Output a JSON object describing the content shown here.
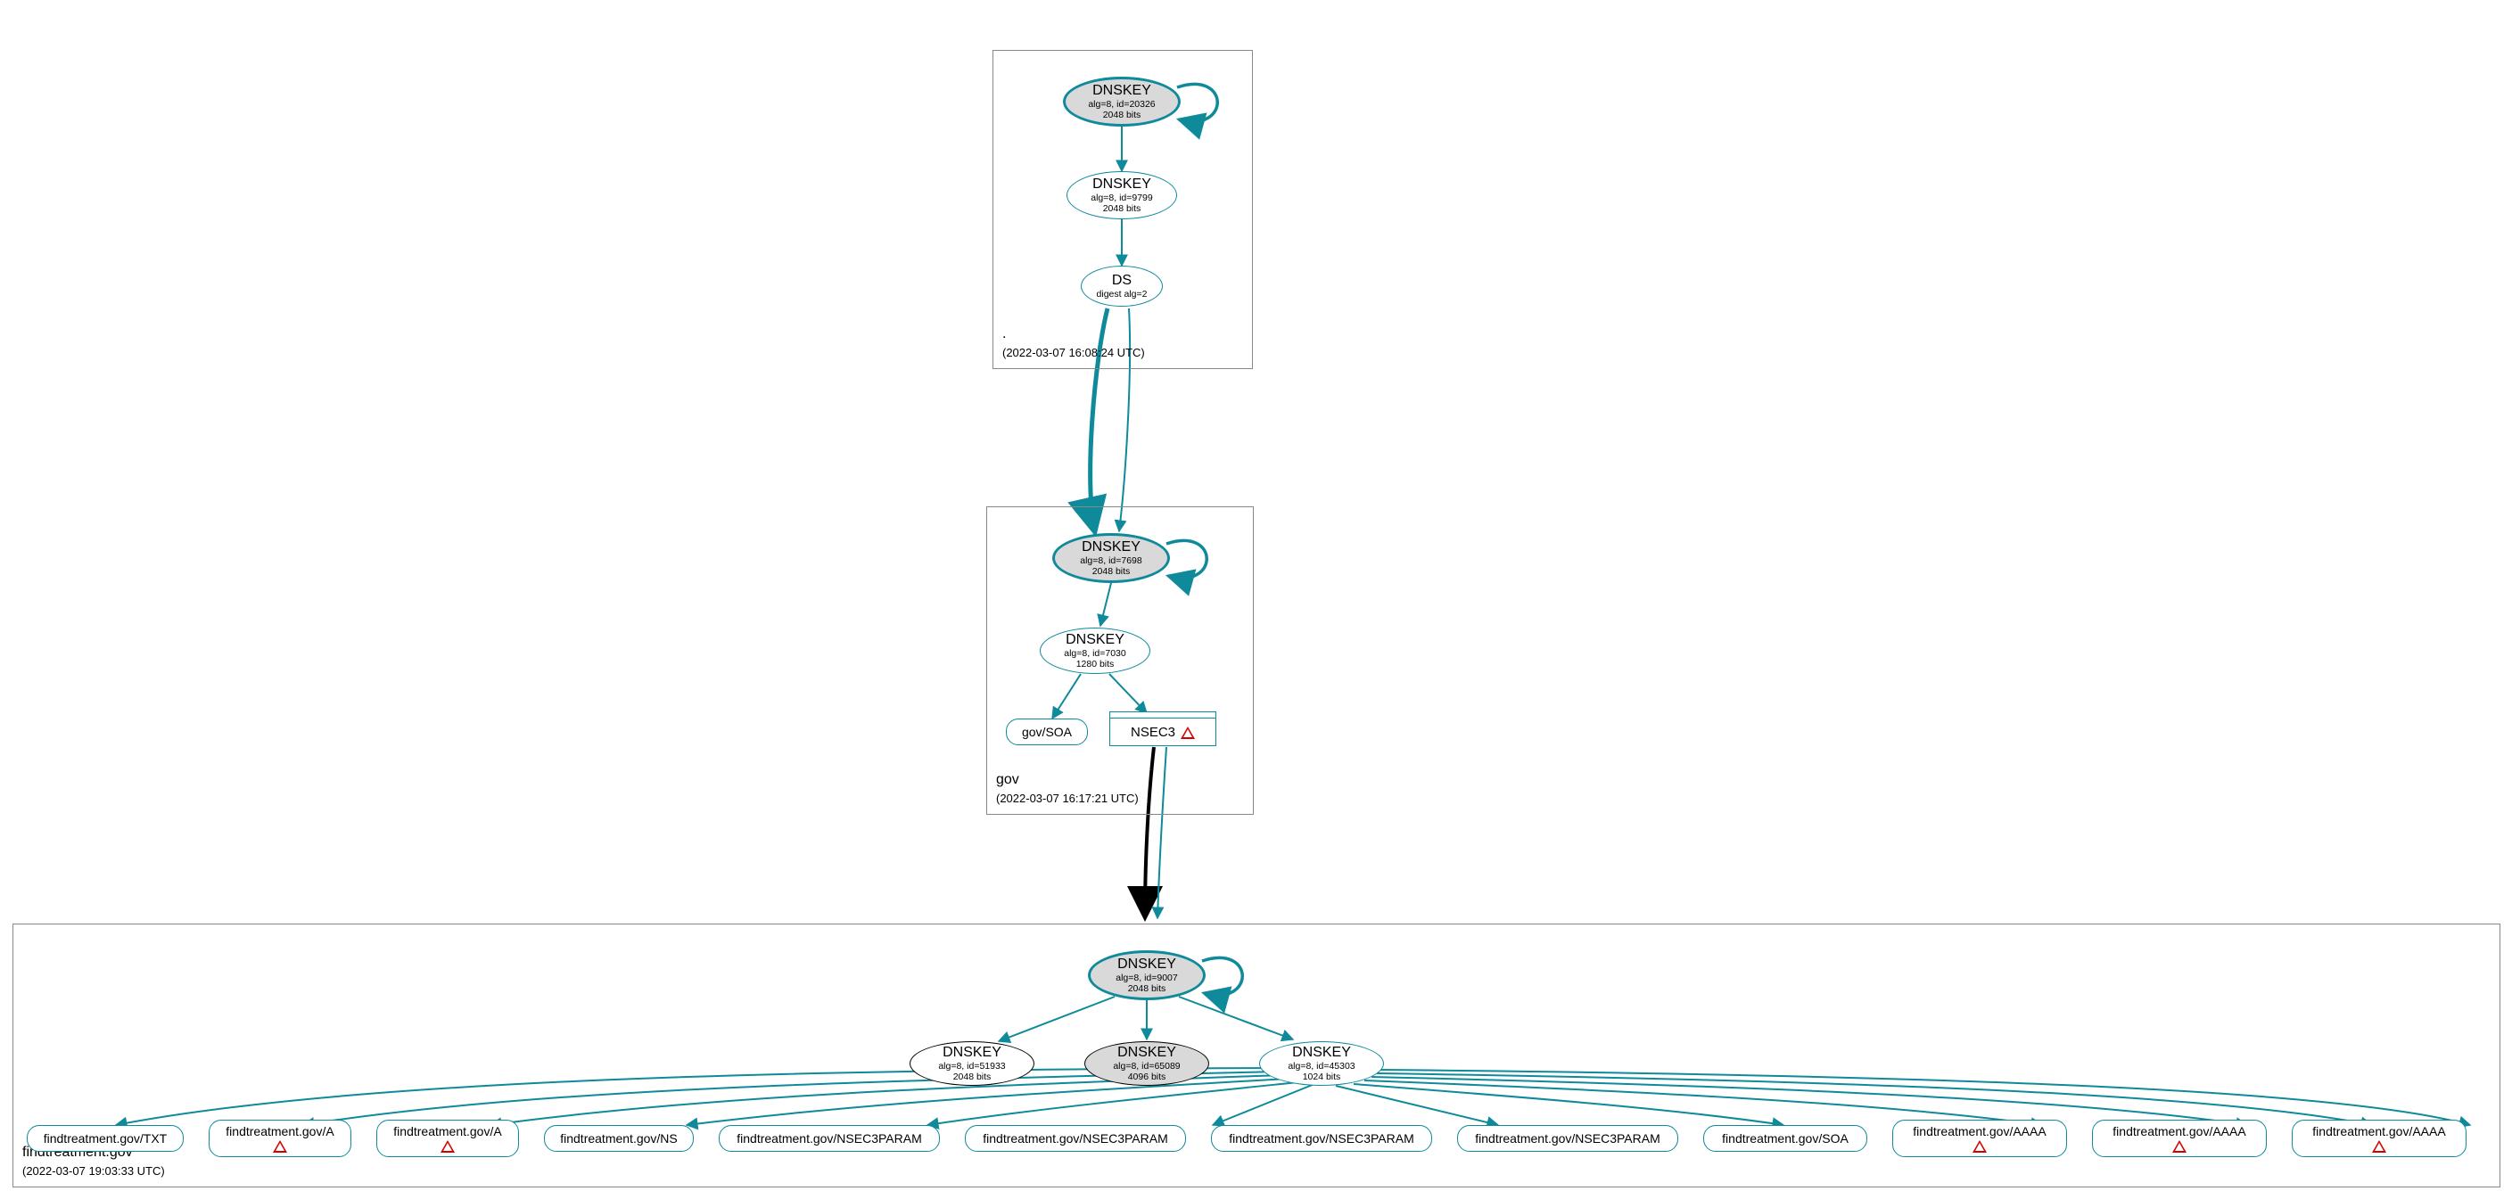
{
  "zones": {
    "root": {
      "name": ".",
      "timestamp": "(2022-03-07 16:08:24 UTC)"
    },
    "gov": {
      "name": "gov",
      "timestamp": "(2022-03-07 16:17:21 UTC)"
    },
    "findtreatment": {
      "name": "findtreatment.gov",
      "timestamp": "(2022-03-07 19:03:33 UTC)"
    }
  },
  "dnskeys": {
    "root_ksk": {
      "title": "DNSKEY",
      "sub": "alg=8, id=20326",
      "bits": "2048 bits"
    },
    "root_zsk": {
      "title": "DNSKEY",
      "sub": "alg=8, id=9799",
      "bits": "2048 bits"
    },
    "gov_ksk": {
      "title": "DNSKEY",
      "sub": "alg=8, id=7698",
      "bits": "2048 bits"
    },
    "gov_zsk": {
      "title": "DNSKEY",
      "sub": "alg=8, id=7030",
      "bits": "1280 bits"
    },
    "ft_ksk": {
      "title": "DNSKEY",
      "sub": "alg=8, id=9007",
      "bits": "2048 bits"
    },
    "ft_51933": {
      "title": "DNSKEY",
      "sub": "alg=8, id=51933",
      "bits": "2048 bits"
    },
    "ft_65089": {
      "title": "DNSKEY",
      "sub": "alg=8, id=65089",
      "bits": "4096 bits"
    },
    "ft_45303": {
      "title": "DNSKEY",
      "sub": "alg=8, id=45303",
      "bits": "1024 bits"
    }
  },
  "ds": {
    "title": "DS",
    "sub": "digest alg=2"
  },
  "records": {
    "gov_soa": "gov/SOA",
    "nsec3": "NSEC3",
    "ft_txt": "findtreatment.gov/TXT",
    "ft_a1": "findtreatment.gov/A",
    "ft_a2": "findtreatment.gov/A",
    "ft_ns": "findtreatment.gov/NS",
    "ft_n3p1": "findtreatment.gov/NSEC3PARAM",
    "ft_n3p2": "findtreatment.gov/NSEC3PARAM",
    "ft_n3p3": "findtreatment.gov/NSEC3PARAM",
    "ft_n3p4": "findtreatment.gov/NSEC3PARAM",
    "ft_soa": "findtreatment.gov/SOA",
    "ft_aaaa1": "findtreatment.gov/AAAA",
    "ft_aaaa2": "findtreatment.gov/AAAA",
    "ft_aaaa3": "findtreatment.gov/AAAA"
  },
  "colors": {
    "teal": "#0e8a9a",
    "black": "#000000",
    "warn": "#d40000"
  },
  "chart_data": {
    "type": "diagram",
    "description": "DNSSEC authentication chain / DNSViz graph",
    "zones": [
      {
        "name": ".",
        "analyzed": "2022-03-07 16:08:24 UTC",
        "keys": [
          {
            "rr": "DNSKEY",
            "alg": 8,
            "id": 20326,
            "bits": 2048,
            "role": "KSK",
            "self_sign": true
          },
          {
            "rr": "DNSKEY",
            "alg": 8,
            "id": 9799,
            "bits": 2048,
            "role": "ZSK"
          }
        ],
        "ds_to_child": {
          "rr": "DS",
          "digest_alg": 2,
          "child": "gov"
        }
      },
      {
        "name": "gov",
        "analyzed": "2022-03-07 16:17:21 UTC",
        "keys": [
          {
            "rr": "DNSKEY",
            "alg": 8,
            "id": 7698,
            "bits": 2048,
            "role": "KSK",
            "self_sign": true
          },
          {
            "rr": "DNSKEY",
            "alg": 8,
            "id": 7030,
            "bits": 1280,
            "role": "ZSK"
          }
        ],
        "signed_rrsets": [
          "gov/SOA",
          "NSEC3"
        ],
        "nsec3_status": "warning",
        "delegation_to": "findtreatment.gov",
        "insecure_delegation": true
      },
      {
        "name": "findtreatment.gov",
        "analyzed": "2022-03-07 19:03:33 UTC",
        "keys": [
          {
            "rr": "DNSKEY",
            "alg": 8,
            "id": 9007,
            "bits": 2048,
            "role": "KSK",
            "self_sign": true
          },
          {
            "rr": "DNSKEY",
            "alg": 8,
            "id": 51933,
            "bits": 2048
          },
          {
            "rr": "DNSKEY",
            "alg": 8,
            "id": 65089,
            "bits": 4096,
            "highlighted": true
          },
          {
            "rr": "DNSKEY",
            "alg": 8,
            "id": 45303,
            "bits": 1024,
            "role": "ZSK"
          }
        ],
        "signed_rrsets": [
          {
            "name": "findtreatment.gov/TXT",
            "status": "ok"
          },
          {
            "name": "findtreatment.gov/A",
            "status": "warning"
          },
          {
            "name": "findtreatment.gov/A",
            "status": "warning"
          },
          {
            "name": "findtreatment.gov/NS",
            "status": "ok"
          },
          {
            "name": "findtreatment.gov/NSEC3PARAM",
            "status": "ok"
          },
          {
            "name": "findtreatment.gov/NSEC3PARAM",
            "status": "ok"
          },
          {
            "name": "findtreatment.gov/NSEC3PARAM",
            "status": "ok"
          },
          {
            "name": "findtreatment.gov/NSEC3PARAM",
            "status": "ok"
          },
          {
            "name": "findtreatment.gov/SOA",
            "status": "ok"
          },
          {
            "name": "findtreatment.gov/AAAA",
            "status": "warning"
          },
          {
            "name": "findtreatment.gov/AAAA",
            "status": "warning"
          },
          {
            "name": "findtreatment.gov/AAAA",
            "status": "warning"
          }
        ]
      }
    ]
  }
}
